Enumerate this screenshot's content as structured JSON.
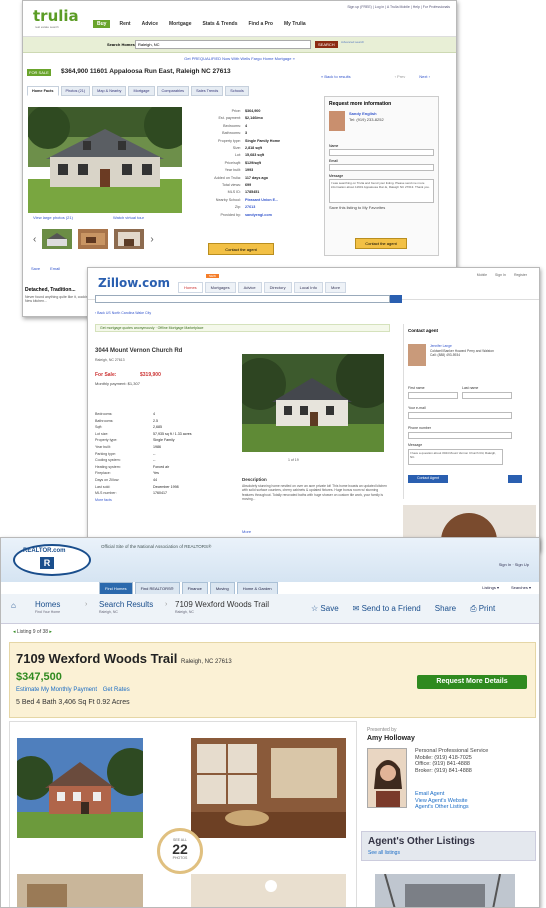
{
  "trulia": {
    "logo": "trulia",
    "logo_sub": "real estate search",
    "signin": "Sign up (FREE) | Log in | A Trulia Mobile | Help | For Professionals",
    "nav": [
      "Buy",
      "Rent",
      "Advice",
      "Mortgage",
      "Stats & Trends",
      "Find a Pro",
      "My Trulia"
    ],
    "search_label": "Search Homes",
    "search_value": "Raleigh, NC",
    "search_button": "SEARCH",
    "advanced": "Advanced search",
    "promo": "Get PREQUALIFIED Now With Wells Fargo Home Mortgage »",
    "for_sale": "FOR SALE",
    "address_line": "$364,900  11601 Appaloosa Run East, Raleigh NC 27613",
    "back": "« Back to results",
    "prev": "‹ Prev",
    "next": "Next ›",
    "tabs": [
      "Home Facts",
      "Photos (21)",
      "Map & Nearby",
      "Mortgage",
      "Comparables",
      "Sales Trends",
      "Schools"
    ],
    "facts": [
      {
        "k": "Price:",
        "v": "$364,900"
      },
      {
        "k": "Est. payment:",
        "v": "$2,146/mo"
      },
      {
        "k": "Bedrooms:",
        "v": "4"
      },
      {
        "k": "Bathrooms:",
        "v": "3"
      },
      {
        "k": "Property type:",
        "v": "Single Family Home"
      },
      {
        "k": "Size:",
        "v": "2,818 sqft"
      },
      {
        "k": "Lot:",
        "v": "15,683 sqft"
      },
      {
        "k": "Price/sqft:",
        "v": "$129/sqft"
      },
      {
        "k": "Year built:",
        "v": "1993"
      },
      {
        "k": "Added on Trulia:",
        "v": "117 days ago"
      },
      {
        "k": "Total views:",
        "v": "699"
      },
      {
        "k": "MLS ID:",
        "v": "1785451"
      },
      {
        "k": "Nearby School:",
        "v": "Pleasant Union E..."
      },
      {
        "k": "Zip:",
        "v": "27613"
      },
      {
        "k": "Provided by:",
        "v": "sandyengl.com"
      }
    ],
    "contact_btn": "Contact the agent",
    "request_header": "Request more information",
    "agent_name": "Sandy English",
    "agent_phone": "Tel: (919) 233-8252",
    "field_name": "Name",
    "field_email": "Email",
    "field_message": "Message",
    "message_text": "I was searching on Trulia and found your listing. Please send me more information about 11601 Appaloosa Run E, Raleigh NC 27613. Thank you.",
    "save_favorites": "Save this listing to My Favorites",
    "send_btn": "Contact the agent",
    "view_large": "View large photos (21)",
    "watch_tour": "Watch virtual tour",
    "save_link": "Save",
    "email_link": "Email",
    "bottom_title": "Detached, Tradition...",
    "bottom_sub": "Never found anything quite like it, cooking, New kitchen..."
  },
  "zillow": {
    "logo": "Zillow.com",
    "nav": [
      "Homes",
      "Mortgages",
      "Advice",
      "Directory",
      "Local Info",
      "More"
    ],
    "new_badge": "NEW",
    "top_links": [
      "Mobile",
      "Sign In",
      "Register"
    ],
    "crumb": "‹ Back   US   North Carolina   Wake   City",
    "green_bar": "Get mortgage quotes anonymously  ·  Offline Mortgage Marketplace",
    "address": "3044 Mount Vernon Church Rd",
    "city": "Raleigh, NC 27613",
    "for_sale": "For Sale:",
    "price": "$319,900",
    "zestimate": "Monthly payment:  $1,307",
    "facts": [
      {
        "k": "Bedrooms:",
        "v": "4"
      },
      {
        "k": "Bathrooms:",
        "v": "2.5"
      },
      {
        "k": "Sqft:",
        "v": "2,685"
      },
      {
        "k": "Lot size:",
        "v": "57,935 sq ft / 1.33 acres"
      },
      {
        "k": "Property type:",
        "v": "Single Family"
      },
      {
        "k": "Year built:",
        "v": "1986"
      },
      {
        "k": "Parking type:",
        "v": "--"
      },
      {
        "k": "Cooling system:",
        "v": "--"
      },
      {
        "k": "Heating system:",
        "v": "Forced air"
      },
      {
        "k": "Fireplace:",
        "v": "Yes"
      },
      {
        "k": "Days on Zillow:",
        "v": "44"
      },
      {
        "k": "Last sold:",
        "v": "December 1998"
      },
      {
        "k": "MLS number:",
        "v": "1760417"
      }
    ],
    "more_facts": "More facts",
    "pager": "1 of 19",
    "desc_title": "Description",
    "desc": "Absolutely stunning home nestled on over an acre private lot! This home boasts an updated kitchen with solid surface counters, cherry cabinets & updated fixtures. Huge bonus room w/ stunning features throughout. Totally renovated baths with huge shower on custom tile work, your family is moving...",
    "more": "More",
    "contact_header": "Contact agent",
    "agent_name": "Jennifer Lange",
    "agent_info": "Coldwell Banker Howard Perry and Walston",
    "agent_phone": "Call: (888) 493-5934",
    "first_name": "First name",
    "last_name": "Last name",
    "email": "Your e-mail",
    "phone": "Phone number",
    "message": "Message",
    "message_text": "I have a question about 3044 Mount Vernon Church Rd, Raleigh, NC.",
    "send": "Contact Agent"
  },
  "realtor": {
    "logo": "REALTOR.com",
    "logo_r": "R",
    "official": "Official Site of the National Association of REALTORS®",
    "topright": "Sign In  ·  Sign Up",
    "nav": [
      "Find Homes",
      "Find REALTORS®",
      "Finance",
      "Moving",
      "Home & Garden"
    ],
    "nav_right": [
      "Listings ▾",
      "Searches ▾"
    ],
    "crumb1": "Homes",
    "crumb1_sub": "Find Your Home",
    "crumb2": "Search Results",
    "crumb2_sub": "Raleigh, NC",
    "crumb3": "7109 Wexford Woods Trail",
    "crumb3_sub": "Raleigh, NC",
    "save": "Save",
    "send": "Send to a Friend",
    "share": "Share",
    "print": "Print",
    "listing": "Listing 9 of 38",
    "address": "7109 Wexford Woods Trail",
    "city": "Raleigh, NC 27613",
    "price": "$347,500",
    "estimate": "Estimate My Monthly Payment",
    "rates": "Get Rates",
    "stats": "5 Bed   4 Bath   3,406 Sq Ft   0.92 Acres",
    "request": "Request More Details",
    "badge_top": "SEE ALL",
    "badge_num": "22",
    "badge_bottom": "PHOTOS",
    "presented": "Presented by",
    "agent_name": "Amy Holloway",
    "agent_info": [
      "Personal Professional Service",
      "Mobile: (919) 418-7025",
      "Office: (919) 841-4888",
      "Broker: (919) 841-4888"
    ],
    "agent_links": [
      "Email Agent",
      "View Agent's Website",
      "Agent's Other Listings"
    ],
    "other_title": "Agent's Other Listings",
    "other_sub": "See all listings"
  }
}
